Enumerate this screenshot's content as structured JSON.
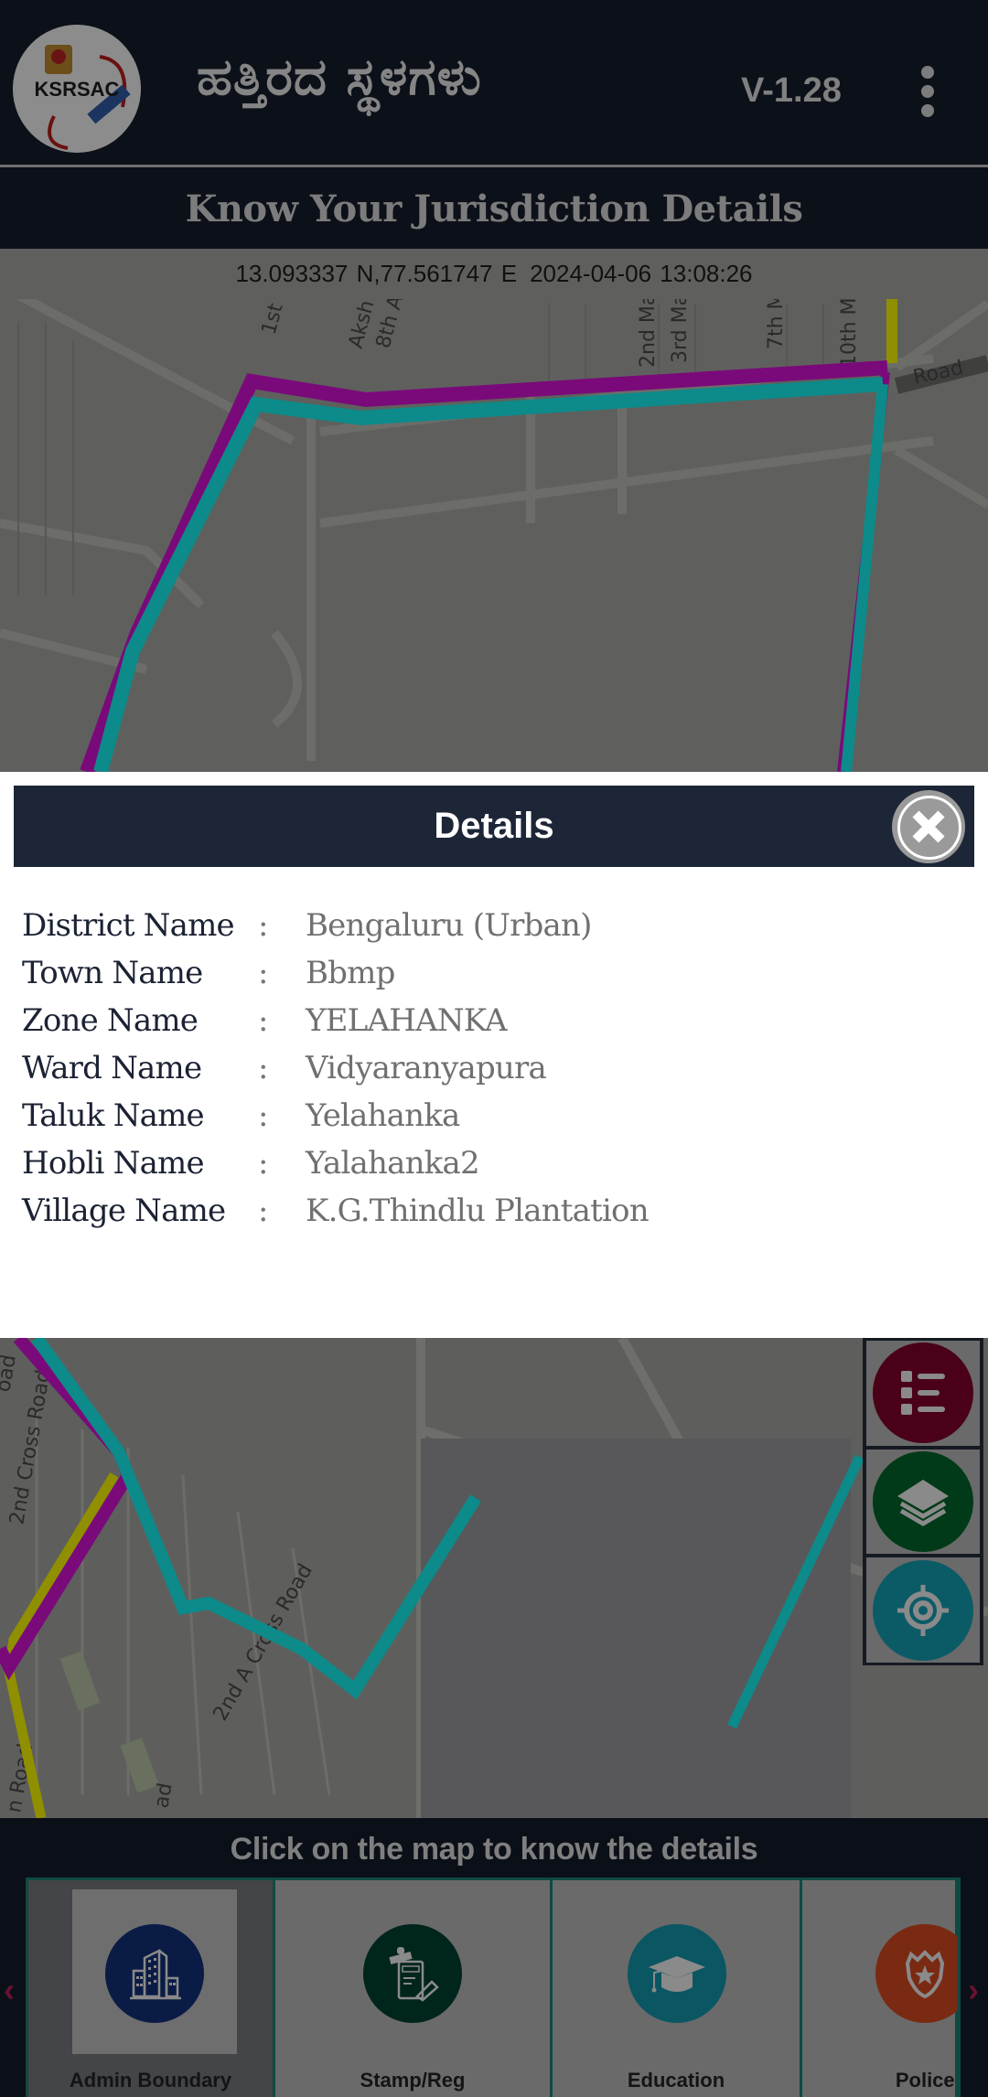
{
  "header": {
    "logo_text": "KSRSAC",
    "title": "ಹತ್ತಿರದ ಸ್ಥಳಗಳು",
    "version": "V-1.28",
    "menu_icon": "more-vertical-icon"
  },
  "subheader": {
    "title": "Know Your Jurisdiction Details"
  },
  "map": {
    "coordinates": "13.093337 N,77.561747 E",
    "timestamp": "2024-04-06 13:08:26",
    "labels_top": [
      "1st",
      "Aksh",
      "8th A",
      "2nd Ma",
      "3rd Ma",
      "7th M",
      "10th M",
      "Road"
    ],
    "labels_bottom": [
      "oad",
      "2nd Cross Road",
      "2nd A Cross Road",
      "n Road",
      "ad"
    ],
    "boundary_colors": {
      "ward": "#7a0a7a",
      "zone": "#0d8a8a",
      "taluk": "#8f8f00"
    }
  },
  "details": {
    "title": "Details",
    "close_icon": "close-circle-icon",
    "separator": ":",
    "rows": [
      {
        "label": "District Name",
        "value": "Bengaluru (Urban)"
      },
      {
        "label": "Town Name",
        "value": "Bbmp"
      },
      {
        "label": "Zone Name",
        "value": "YELAHANKA"
      },
      {
        "label": "Ward Name",
        "value": "Vidyaranyapura"
      },
      {
        "label": "Taluk Name",
        "value": "Yelahanka"
      },
      {
        "label": "Hobli Name",
        "value": "Yalahanka2"
      },
      {
        "label": "Village Name",
        "value": "K.G.Thindlu Plantation"
      }
    ]
  },
  "fabs": [
    {
      "name": "legend",
      "icon": "list-icon",
      "color": "#4a0019"
    },
    {
      "name": "layers",
      "icon": "layers-icon",
      "color": "#003a18"
    },
    {
      "name": "my-location",
      "icon": "locate-icon",
      "color": "#0b5b66"
    }
  ],
  "bottom": {
    "hint": "Click on the map to know the details",
    "prev_icon": "chevron-left-icon",
    "next_icon": "chevron-right-icon",
    "categories": [
      {
        "label": "Admin Boundary",
        "icon": "building-icon",
        "color": "#0a1c45",
        "active": true
      },
      {
        "label": "Stamp/Reg",
        "icon": "stamp-document-icon",
        "color": "#00251d",
        "active": false
      },
      {
        "label": "Education",
        "icon": "graduation-cap-icon",
        "color": "#0a5662",
        "active": false
      },
      {
        "label": "Police Sta",
        "icon": "police-badge-icon",
        "color": "#7a2a12",
        "active": false
      }
    ]
  }
}
